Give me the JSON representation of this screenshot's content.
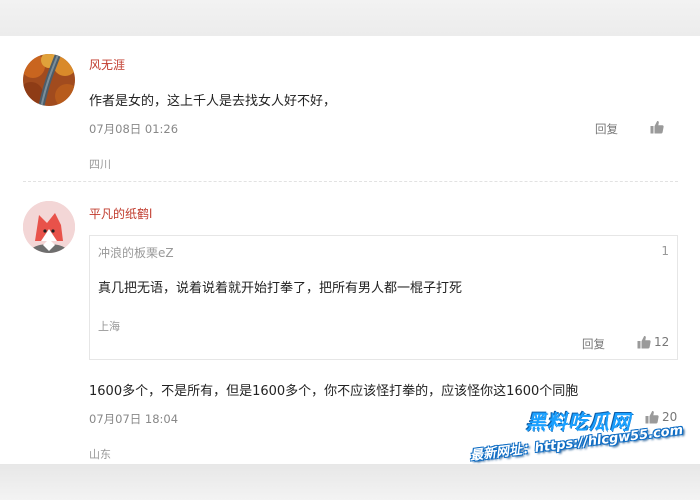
{
  "comments": [
    {
      "username": "风无涯",
      "text": "作者是女的，这上千人是去找女人好不好，",
      "time": "07月08日 01:26",
      "reply_label": "回复",
      "like_count": "",
      "location": "四川"
    },
    {
      "username": "平凡的纸鹤l",
      "quote": {
        "author": "冲浪的板栗eZ",
        "floor": "1",
        "text": "真几把无语，说着说着就开始打拳了，把所有男人都一棍子打死",
        "location": "上海",
        "reply_label": "回复",
        "like_count": "12"
      },
      "text": "1600多个，不是所有，但是1600多个，你不应该怪打拳的，应该怪你这1600个同胞",
      "time": "07月07日 18:04",
      "like_count": "20",
      "location": "山东"
    }
  ],
  "watermark": {
    "title": "黑料吃瓜网",
    "url": "最新网址：https://hlcgw55.com"
  },
  "colors": {
    "username": "#c0392b",
    "watermark": "#1aa0ff"
  }
}
